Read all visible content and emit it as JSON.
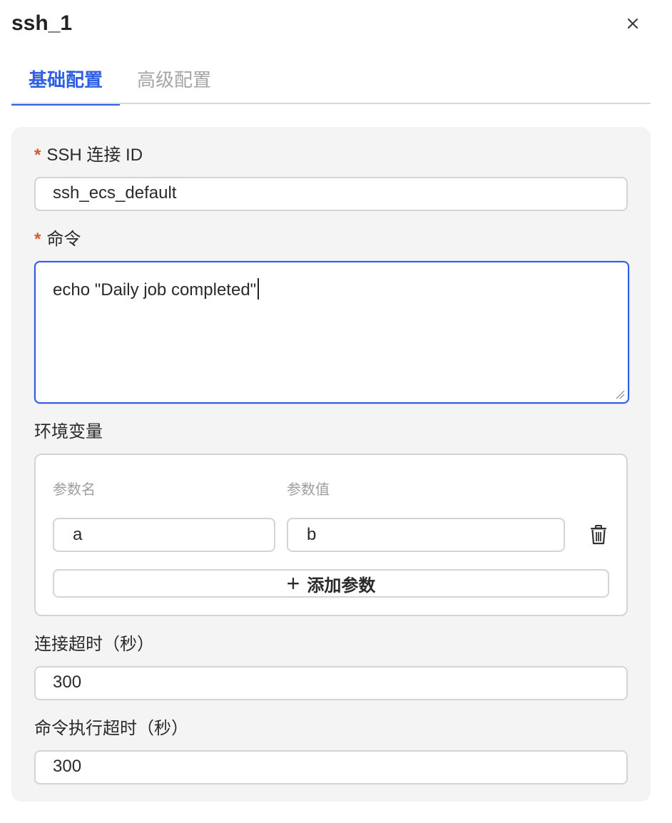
{
  "header": {
    "title": "ssh_1",
    "close_icon": "close-icon"
  },
  "tabs": [
    {
      "label": "基础配置",
      "active": true
    },
    {
      "label": "高级配置",
      "active": false
    }
  ],
  "form": {
    "ssh_conn": {
      "required_mark": "*",
      "label": "SSH 连接 ID",
      "value": "ssh_ecs_default"
    },
    "command": {
      "required_mark": "*",
      "label": "命令",
      "value": "echo \"Daily job completed\""
    },
    "env": {
      "label": "环境变量",
      "col_name": "参数名",
      "col_value": "参数值",
      "rows": [
        {
          "name": "a",
          "value": "b"
        }
      ],
      "add_icon": "+",
      "add_label": "添加参数"
    },
    "conn_timeout": {
      "label": "连接超时（秒）",
      "value": "300"
    },
    "cmd_timeout": {
      "label": "命令执行超时（秒）",
      "value": "300"
    }
  },
  "colors": {
    "accent": "#2f5fe0",
    "required": "#d6582b"
  }
}
